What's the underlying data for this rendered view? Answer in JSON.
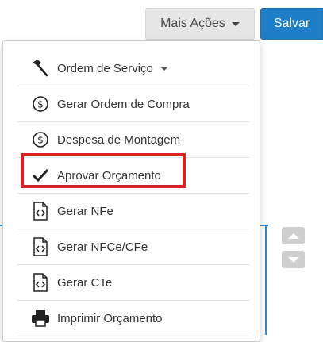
{
  "toolbar": {
    "more_actions_label": "Mais Ações",
    "save_label": "Salvar"
  },
  "menu": {
    "items": [
      {
        "label": "Ordem de Serviço",
        "icon": "hammer-icon",
        "has_submenu": true
      },
      {
        "label": "Gerar Ordem de Compra",
        "icon": "dollar-circle-icon"
      },
      {
        "label": "Despesa de Montagem",
        "icon": "dollar-circle-icon"
      },
      {
        "label": "Aprovar Orçamento",
        "icon": "checkmark-icon",
        "highlighted": true
      },
      {
        "label": "Gerar NFe",
        "icon": "code-file-icon"
      },
      {
        "label": "Gerar NFCe/CFe",
        "icon": "code-file-icon"
      },
      {
        "label": "Gerar CTe",
        "icon": "code-file-icon"
      },
      {
        "label": "Imprimir Orçamento",
        "icon": "printer-icon"
      }
    ]
  },
  "colors": {
    "primary": "#1f7ec8",
    "highlight": "#dd2024",
    "default_button": "#e6e6e6"
  }
}
